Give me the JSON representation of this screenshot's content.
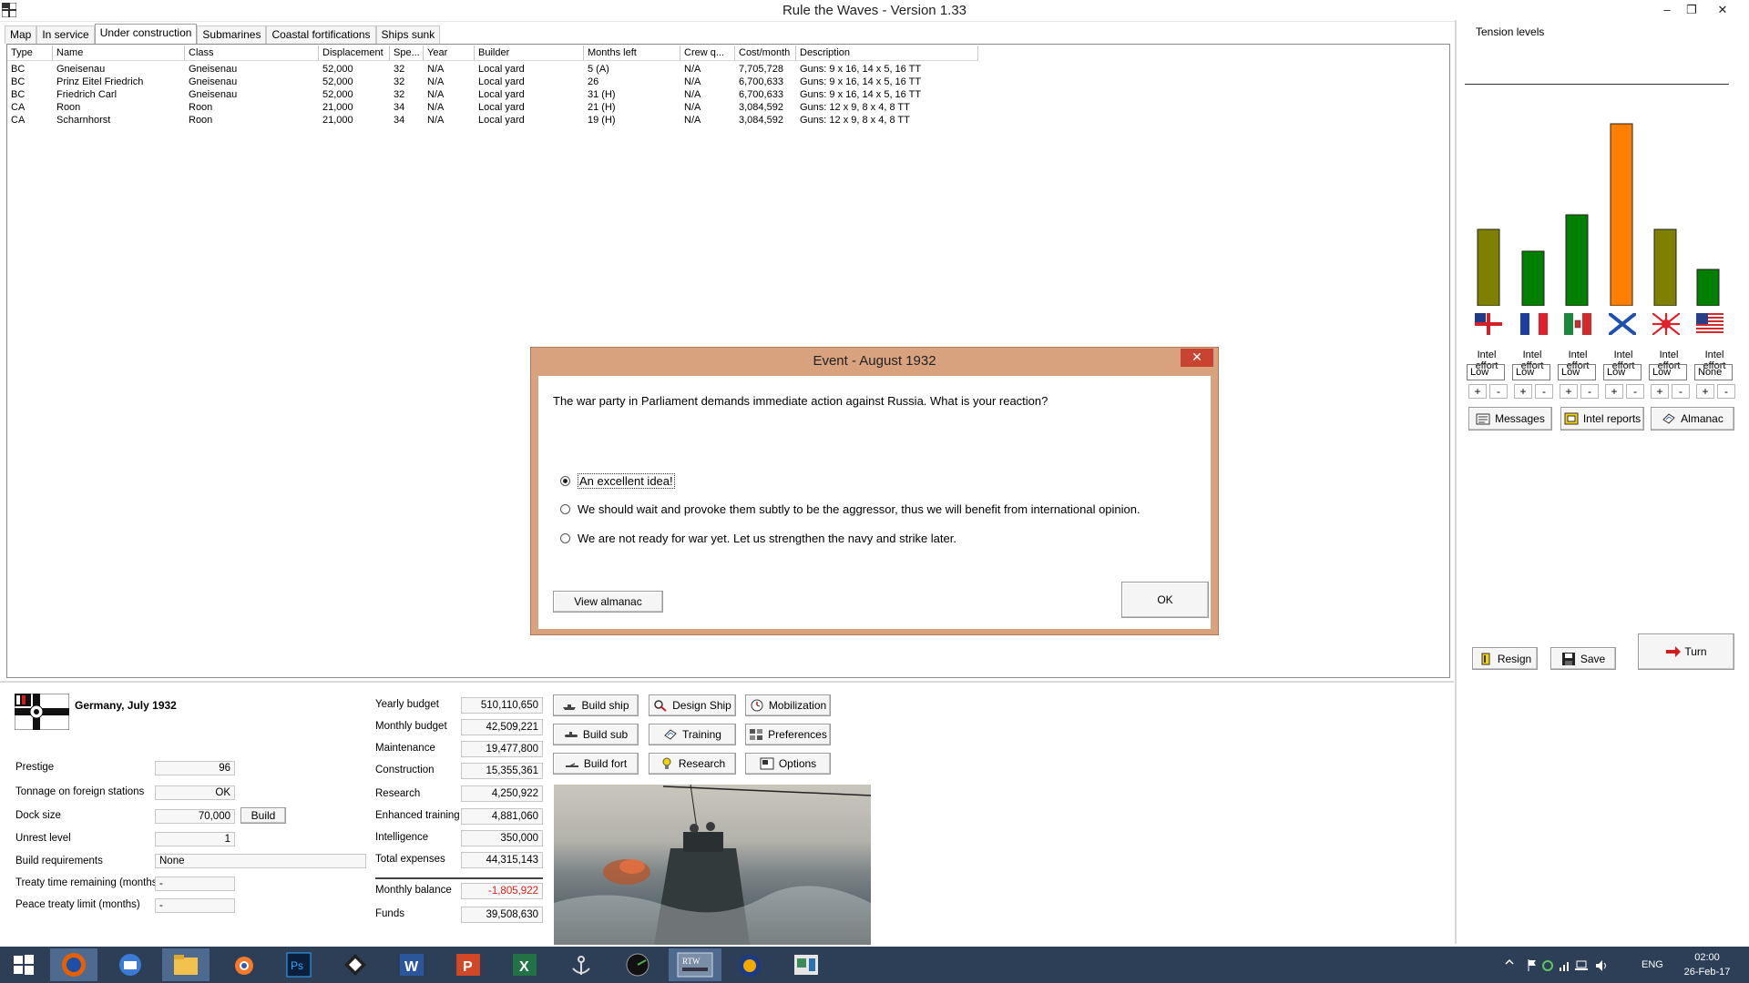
{
  "window": {
    "title": "Rule the Waves - Version 1.33",
    "minimize": "–",
    "restore": "❐",
    "close": "✕"
  },
  "tabs": [
    "Map",
    "In service",
    "Under construction",
    "Submarines",
    "Coastal fortifications",
    "Ships sunk"
  ],
  "active_tab": "Under construction",
  "ship_list": {
    "columns": [
      "Type",
      "Name",
      "Class",
      "Displacement",
      "Spe...",
      "Year",
      "Builder",
      "Months left",
      "Crew q...",
      "Cost/month",
      "Description"
    ],
    "rows": [
      [
        "BC",
        "Gneisenau",
        "Gneisenau",
        "52,000",
        "32",
        "N/A",
        "Local yard",
        "5 (A)",
        "N/A",
        "7,705,728",
        "Guns: 9 x 16, 14 x 5, 16 TT"
      ],
      [
        "BC",
        "Prinz Eitel Friedrich",
        "Gneisenau",
        "52,000",
        "32",
        "N/A",
        "Local yard",
        "26",
        "N/A",
        "6,700,633",
        "Guns: 9 x 16, 14 x 5, 16 TT"
      ],
      [
        "BC",
        "Friedrich Carl",
        "Gneisenau",
        "52,000",
        "32",
        "N/A",
        "Local yard",
        "31 (H)",
        "N/A",
        "6,700,633",
        "Guns: 9 x 16, 14 x 5, 16 TT"
      ],
      [
        "CA",
        "Roon",
        "Roon",
        "21,000",
        "34",
        "N/A",
        "Local yard",
        "21 (H)",
        "N/A",
        "3,084,592",
        "Guns: 12 x 9, 8 x 4, 8 TT"
      ],
      [
        "CA",
        "Scharnhorst",
        "Roon",
        "21,000",
        "34",
        "N/A",
        "Local yard",
        "19 (H)",
        "N/A",
        "3,084,592",
        "Guns: 12 x 9, 8 x 4, 8 TT"
      ]
    ]
  },
  "tension": {
    "label": "Tension levels",
    "bars": [
      {
        "nation": "Britain",
        "value": 0.42,
        "color": "#7f7f00"
      },
      {
        "nation": "France",
        "value": 0.3,
        "color": "#007f00"
      },
      {
        "nation": "Italy",
        "value": 0.5,
        "color": "#007f00"
      },
      {
        "nation": "Russia",
        "value": 1.0,
        "color": "#ff7f00"
      },
      {
        "nation": "Japan",
        "value": 0.42,
        "color": "#7f7f00"
      },
      {
        "nation": "USA",
        "value": 0.2,
        "color": "#007f00"
      }
    ],
    "intel_label": "Intel effort",
    "intel_values": [
      "Low",
      "Low",
      "Low",
      "Low",
      "Low",
      "None"
    ],
    "plus": "+",
    "minus": "-"
  },
  "right_buttons": {
    "messages": "Messages",
    "intel_reports": "Intel reports",
    "almanac": "Almanac",
    "resign": "Resign",
    "save": "Save",
    "turn": "Turn"
  },
  "dialog": {
    "title": "Event - August 1932",
    "close": "✕",
    "message": "The war party in Parliament demands immediate action against Russia. What is your reaction?",
    "options": [
      "An excellent idea!",
      "We should wait and provoke them subtly to be the aggressor, thus we will benefit from international opinion.",
      "We are not ready for war yet. Let us strengthen the navy and strike later."
    ],
    "selected_index": 0,
    "view_almanac": "View almanac",
    "ok": "OK"
  },
  "nation": {
    "title": "Germany, July 1932",
    "fields": [
      {
        "label": "Prestige",
        "value": "96"
      },
      {
        "label": "Tonnage on foreign stations",
        "value": "OK"
      },
      {
        "label": "Dock size",
        "value": "70,000"
      },
      {
        "label": "Unrest level",
        "value": "1"
      },
      {
        "label": "Build requirements",
        "value": "None"
      },
      {
        "label": "Treaty time remaining (months)",
        "value": "-"
      },
      {
        "label": "Peace treaty limit (months)",
        "value": "-"
      }
    ],
    "build_button": "Build"
  },
  "budget": [
    {
      "label": "Yearly budget",
      "value": "510,110,650"
    },
    {
      "label": "Monthly budget",
      "value": "42,509,221"
    },
    {
      "label": "Maintenance",
      "value": "19,477,800"
    },
    {
      "label": "Construction",
      "value": "15,355,361"
    },
    {
      "label": "Research",
      "value": "4,250,922"
    },
    {
      "label": "Enhanced training",
      "value": "4,881,060"
    },
    {
      "label": "Intelligence",
      "value": "350,000"
    },
    {
      "label": "Total expenses",
      "value": "44,315,143"
    },
    {
      "label": "Monthly balance",
      "value": "-1,805,922"
    },
    {
      "label": "Funds",
      "value": "39,508,630"
    }
  ],
  "action_buttons": {
    "build_ship": "Build ship",
    "design_ship": "Design Ship",
    "mobilization": "Mobilization",
    "build_sub": "Build sub",
    "training": "Training",
    "preferences": "Preferences",
    "build_fort": "Build fort",
    "research": "Research",
    "options": "Options"
  },
  "taskbar": {
    "lang": "ENG",
    "time": "02:00",
    "date": "26-Feb-17"
  }
}
